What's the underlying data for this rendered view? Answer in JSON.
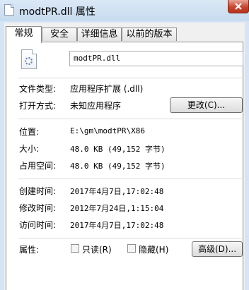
{
  "window": {
    "title": "modtPR.dll 属性",
    "close_label": ""
  },
  "tabs": [
    {
      "label": "常规"
    },
    {
      "label": "安全"
    },
    {
      "label": "详细信息"
    },
    {
      "label": "以前的版本"
    }
  ],
  "general": {
    "filename": "modtPR.dll",
    "file_type_label": "文件类型:",
    "file_type": "应用程序扩展 (.dll)",
    "open_with_label": "打开方式:",
    "open_with": "未知应用程序",
    "change_button": "更改(C)...",
    "location_label": "位置:",
    "location": "E:\\gm\\modtPR\\X86",
    "size_label": "大小:",
    "size": "48.0 KB (49,152 字节)",
    "size_on_disk_label": "占用空间:",
    "size_on_disk": "48.0 KB (49,152 字节)",
    "created_label": "创建时间:",
    "created": "2017年4月7日,17:02:48",
    "modified_label": "修改时间:",
    "modified": "2012年7月24日,1:15:04",
    "accessed_label": "访问时间:",
    "accessed": "2017年4月7日,17:02:48",
    "attributes_label": "属性:",
    "readonly_label": "只读(R)",
    "readonly_checked": false,
    "hidden_label": "隐藏(H)",
    "hidden_checked": false,
    "advanced_button": "高级(D)..."
  }
}
